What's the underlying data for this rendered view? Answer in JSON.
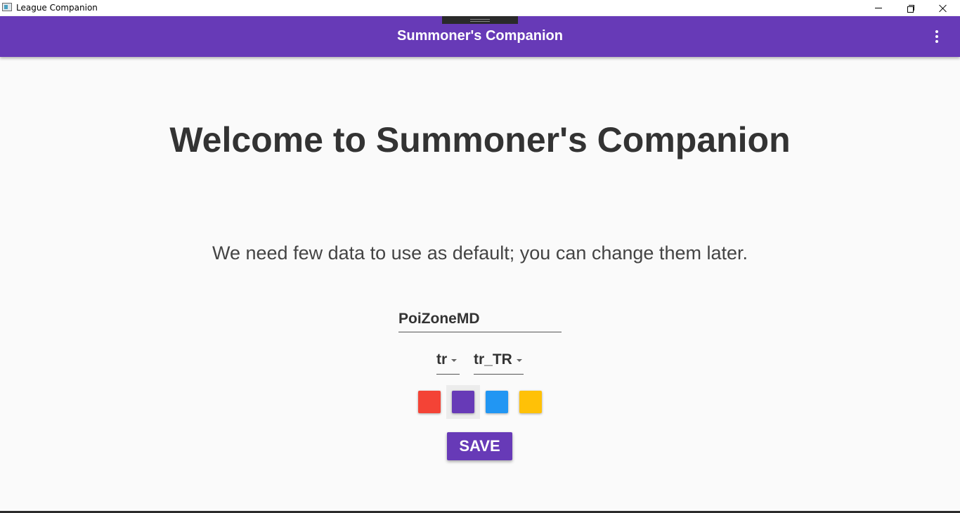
{
  "window": {
    "title": "League Companion"
  },
  "appbar": {
    "title": "Summoner's Companion",
    "menu_icon": "more-vert-icon",
    "color": "#673ab7"
  },
  "main": {
    "heading": "Welcome to Summoner's Companion",
    "subtitle": "We need few data to use as default; you can change them later.",
    "summoner_name": "PoiZoneMD",
    "region": "tr",
    "locale": "tr_TR",
    "theme_colors": [
      "#f44336",
      "#673ab7",
      "#2196f3",
      "#ffc107"
    ],
    "selected_theme_color": "#673ab7",
    "save_label": "SAVE"
  }
}
